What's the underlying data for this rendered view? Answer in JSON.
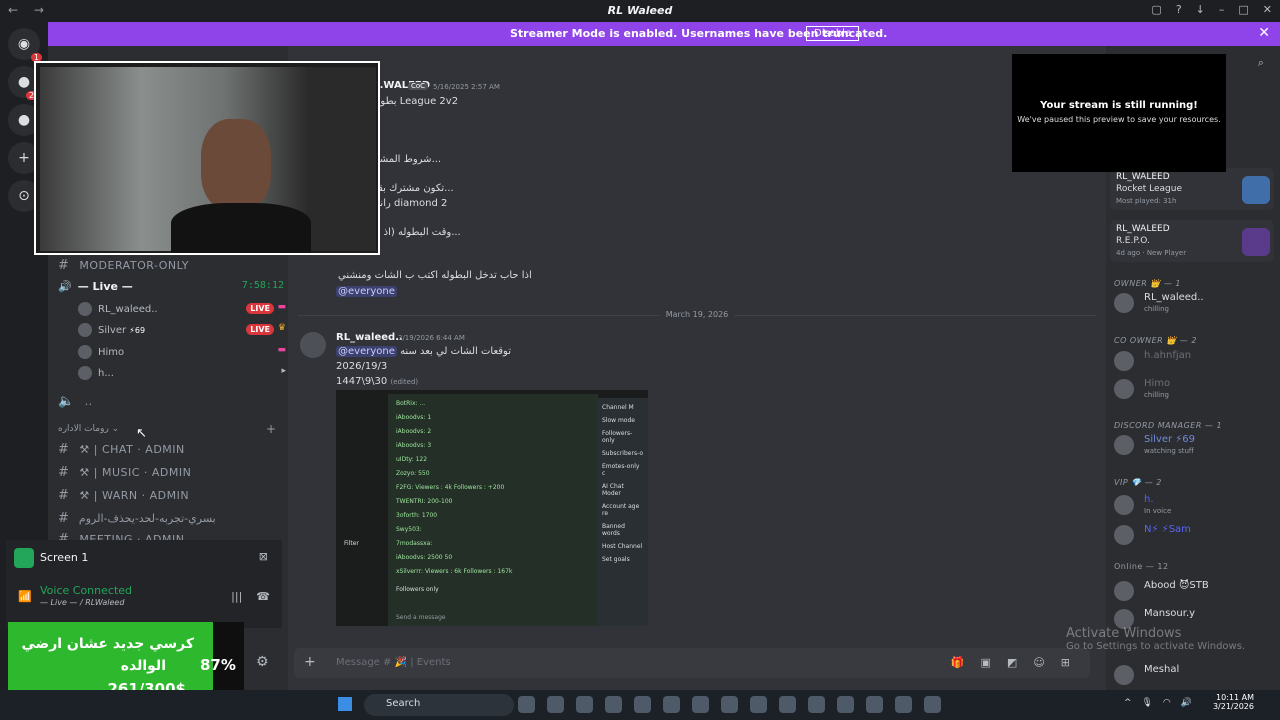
{
  "window": {
    "title": "RL Waleed"
  },
  "banner": {
    "message": "Streamer Mode is enabled. Usernames have been truncated.",
    "disable_label": "Disable"
  },
  "rail": {
    "badge_count": "1",
    "badge2": "20"
  },
  "channels": {
    "moderator_only": "MODERATOR-ONLY",
    "voice_live": "— Live —",
    "voice_timer": "7:58:12",
    "voice_users": [
      {
        "name": "RL_waleed..",
        "live": "LIVE"
      },
      {
        "name": "Silver",
        "extra": "⚡69",
        "live": "LIVE"
      },
      {
        "name": "Himo"
      },
      {
        "name": "h..."
      }
    ],
    "dots": "..",
    "admin_category": "رومات الاداره",
    "admin_channels": [
      "⚒ | CHAT · ADMIN",
      "⚒ | MUSIC · ADMIN",
      "⚒ | WARN · ADMIN",
      "بسري-تجربه-لحد-يحذف-الروم",
      "MEETING · ADMIN"
    ]
  },
  "screen_panel": {
    "name": "Screen 1",
    "voice_connected": "Voice Connected",
    "voice_sub": "— Live — / RLWaleed"
  },
  "goal": {
    "line1": "كرسي جديد عشان ارضي",
    "line2": "الوالده",
    "amount": "261/300$",
    "percent": "87%"
  },
  "messages": {
    "first": {
      "author": "...WALEED",
      "tag": "CoC",
      "timestamp": "5/16/2025 2:57 AM",
      "lines": [
        "بطوله League 2v2",
        "شروط المشار...",
        "تكون مشترك بقنا...",
        "رانك diamond 2",
        "وقت البطوله (اذ الا...",
        "اذا حاب تدخل البطوله اكتب ب الشات ومنشني"
      ],
      "mention": "@everyone"
    },
    "date_divider": "March 19, 2026",
    "second": {
      "author": "RL_waleed..",
      "timestamp": "3/19/2026 6:44 AM",
      "mention": "@everyone",
      "text": "توقعات الشات لي بعد سنه",
      "line2": "2026/19/3",
      "line3": "1447\\9\\30",
      "edited": "(edited)"
    },
    "attachment": {
      "side_items": [
        "Channel M",
        "Slow mode",
        "Followers-only",
        "Subscribers-o",
        "Emotes-only c",
        "AI Chat Moder",
        "Account age re",
        "Banned words",
        "Host Channel",
        "Set goals"
      ],
      "rows": [
        "BotRix: ...",
        "iAboodvs: 1",
        "iAboodvs: 2",
        "iAboodvs: 3",
        "uIDty: 122",
        "Zozyo: 550",
        "F2FG: Viewers : 4k Followers : +200",
        "TWENTRI: 200-100",
        "3oforth: 1700",
        "Swy503:",
        "7modassxa:",
        "iAboodvs: 2500 50",
        "xSilverrr: Viewers : 6k Followers : 167k"
      ],
      "filter": "Filter",
      "followers_only": "Followers only",
      "send": "Send a message"
    }
  },
  "composer": {
    "placeholder": "Message # 🎉 | Events"
  },
  "stream_overlay": {
    "heading": "Your stream is still running!",
    "sub": "We've paused this preview to save your resources."
  },
  "activities": [
    {
      "user": "RL_WALEED",
      "game": "Rocket League",
      "meta": "Most played: 31h"
    },
    {
      "user": "RL_WALEED",
      "game": "R.E.P.O.",
      "meta": "4d ago · New Player"
    }
  ],
  "members": {
    "owner_head": "OWNER 👑 — 1",
    "owner": [
      {
        "name": "RL_waleed..",
        "status": "chilling"
      }
    ],
    "co_owner_head": "CO OWNER 👑 — 2",
    "co_owner": [
      {
        "name": "h.ahnfjan",
        "status": ""
      },
      {
        "name": "Himo",
        "status": "chilling"
      }
    ],
    "dm_head": "DISCORD MANAGER — 1",
    "dm": [
      {
        "name": "Silver ⚡69",
        "status": "watching stuff"
      }
    ],
    "vip_head": "VIP 💎 — 2",
    "vip": [
      {
        "name": "h.",
        "status": "In voice"
      },
      {
        "name": "N⚡ ⚡Sam",
        "status": ""
      }
    ],
    "online_head": "Online — 12",
    "online": [
      {
        "name": "Abood 😈STB",
        "status": ""
      },
      {
        "name": "Mansour.y",
        "status": ""
      },
      {
        "name": "Meshal",
        "status": ""
      }
    ]
  },
  "watermark": {
    "title": "Activate Windows",
    "sub": "Go to Settings to activate Windows."
  },
  "taskbar": {
    "search": "Search",
    "time": "10:11 AM",
    "date": "3/21/2026"
  }
}
